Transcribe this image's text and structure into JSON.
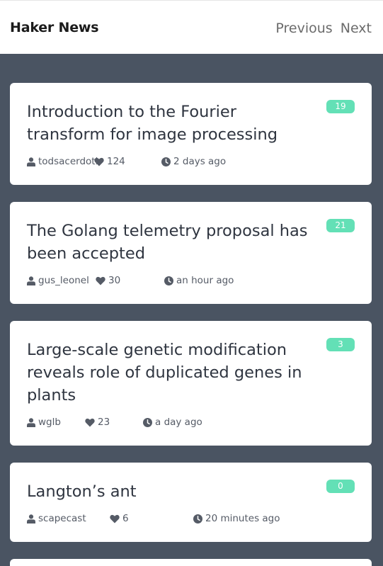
{
  "header": {
    "brand": "Haker News",
    "prev_label": "Previous",
    "next_label": "Next"
  },
  "colors": {
    "background": "#4a5462",
    "badge": "#63e0b6",
    "card": "#ffffff"
  },
  "stories": [
    {
      "title": "Introduction to the Fourier transform for image processing",
      "comments": "19",
      "author": "todsacerdoti",
      "points": "124",
      "time": "2 days ago"
    },
    {
      "title": "The Golang telemetry proposal has been accepted",
      "comments": "21",
      "author": "gus_leonel",
      "points": "30",
      "time": "an hour ago"
    },
    {
      "title": "Large-scale genetic modification reveals role of duplicated genes in plants",
      "comments": "3",
      "author": "wglb",
      "points": "23",
      "time": "a day ago"
    },
    {
      "title": "Langton’s ant",
      "comments": "0",
      "author": "scapecast",
      "points": "6",
      "time": "20 minutes ago"
    }
  ],
  "icons": {
    "author": "user-icon",
    "points": "heart-icon",
    "time": "clock-icon"
  }
}
